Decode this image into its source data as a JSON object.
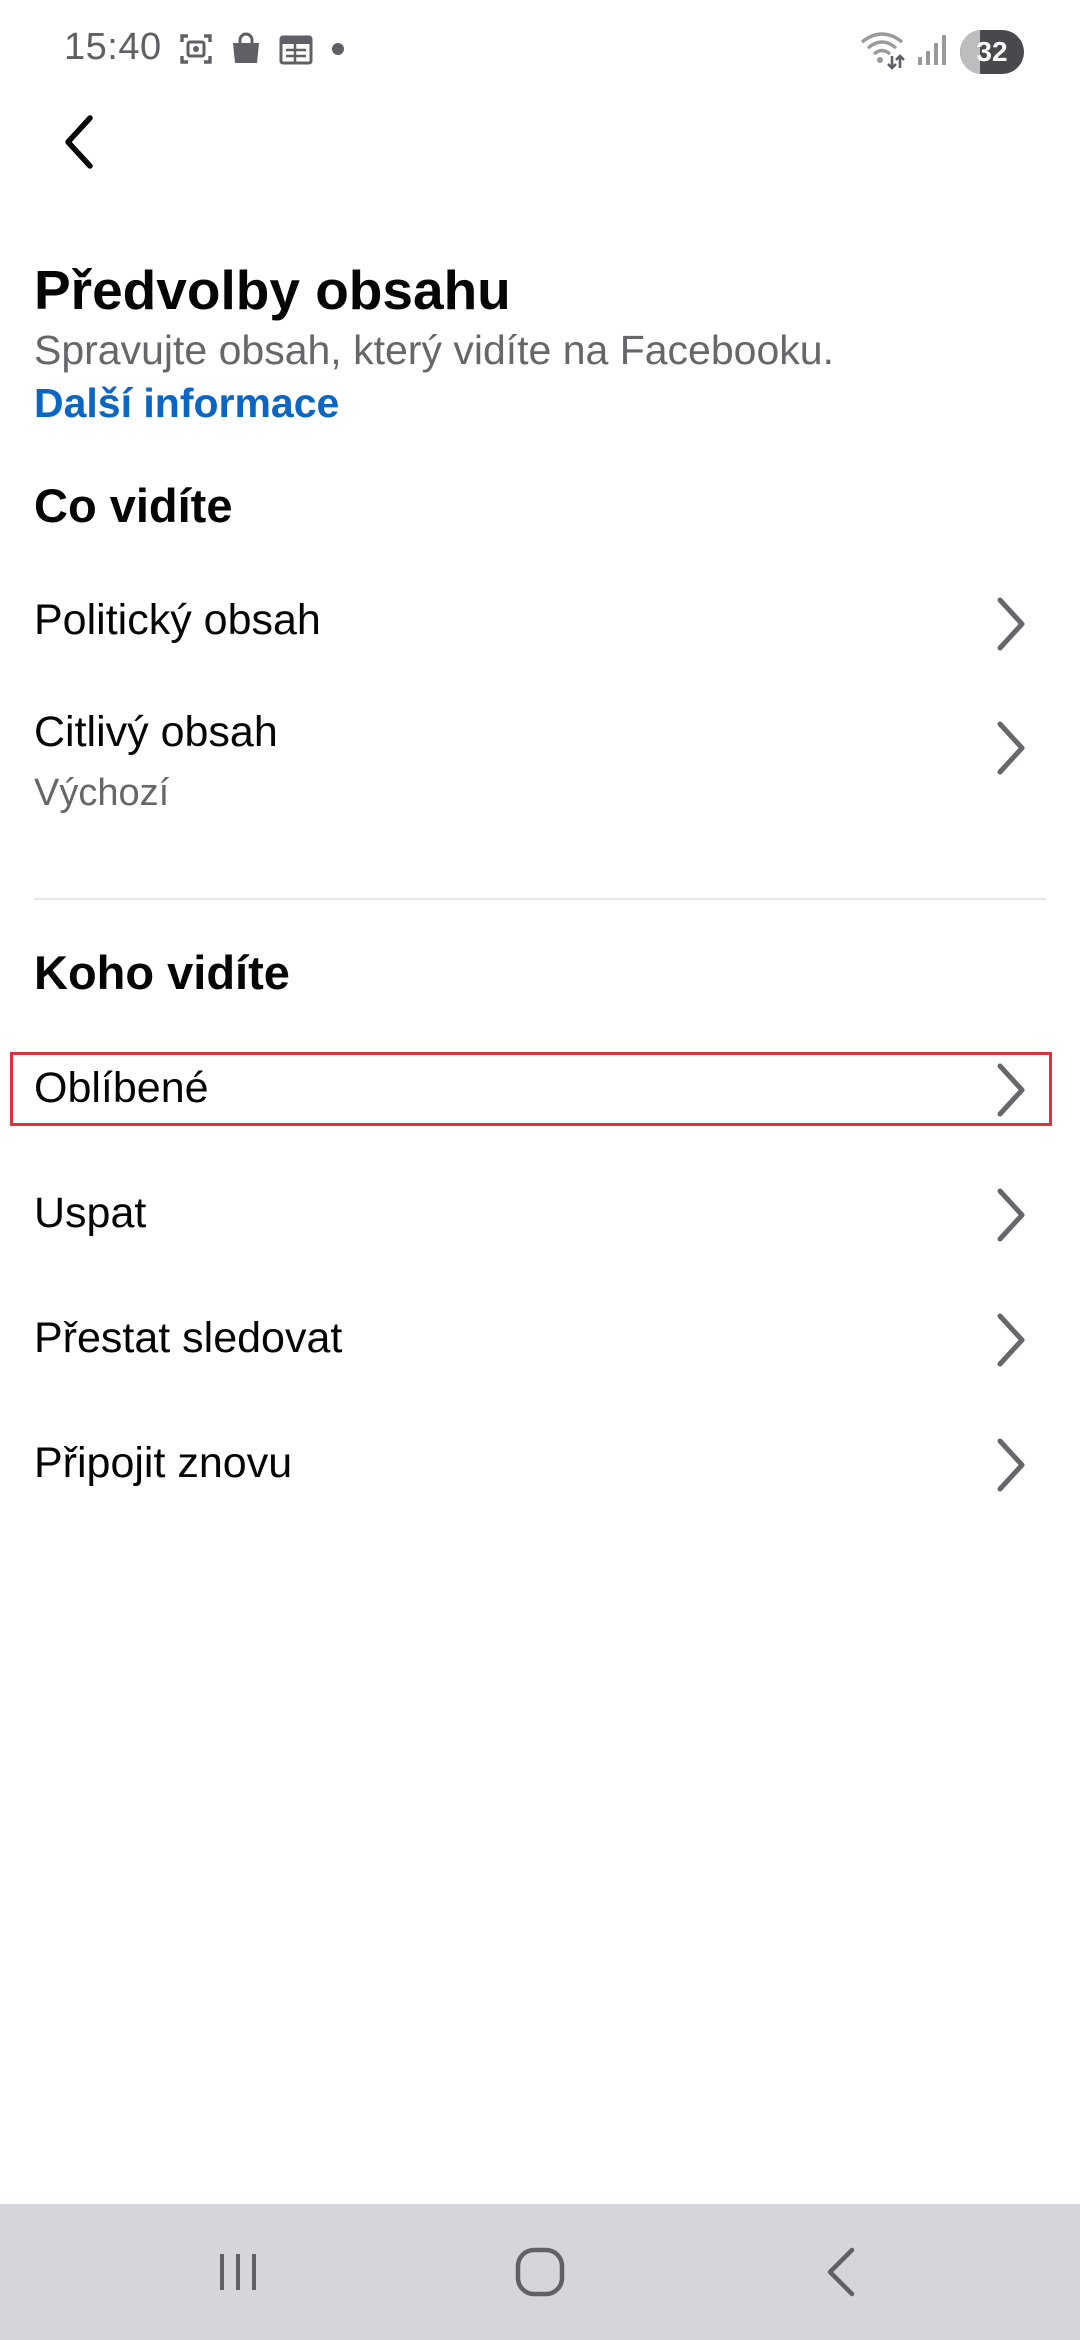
{
  "status_bar": {
    "time": "15:40",
    "battery_level": "32",
    "battery_fraction": 0.32,
    "left_icons": [
      "screenshot-icon",
      "shopping-bag-icon",
      "calendar-icon",
      "notification-dot-icon"
    ],
    "right_icons": [
      "wifi-icon",
      "signal-icon",
      "battery-icon"
    ]
  },
  "header": {
    "back_icon": "back-arrow-icon",
    "title": "Předvolby obsahu",
    "subtitle": "Spravujte obsah, který vidíte na Facebooku.",
    "learn_more": "Další informace"
  },
  "sections": [
    {
      "heading": "Co vidíte",
      "items": [
        {
          "label": "Politický obsah",
          "sublabel": ""
        },
        {
          "label": "Citlivý obsah",
          "sublabel": "Výchozí"
        }
      ]
    },
    {
      "heading": "Koho vidíte",
      "items": [
        {
          "label": "Oblíbené",
          "highlighted": true
        },
        {
          "label": "Uspat"
        },
        {
          "label": "Přestat sledovat"
        },
        {
          "label": "Připojit znovu"
        }
      ]
    }
  ],
  "nav_bar": {
    "buttons": [
      "recent-apps-icon",
      "home-icon",
      "back-icon"
    ]
  },
  "colors": {
    "link": "#0a66c2",
    "text": "#050505",
    "secondary_text": "#65676b",
    "chevron": "#65676b",
    "highlight": "#d9343f",
    "nav_bar": "#d5d6da"
  }
}
